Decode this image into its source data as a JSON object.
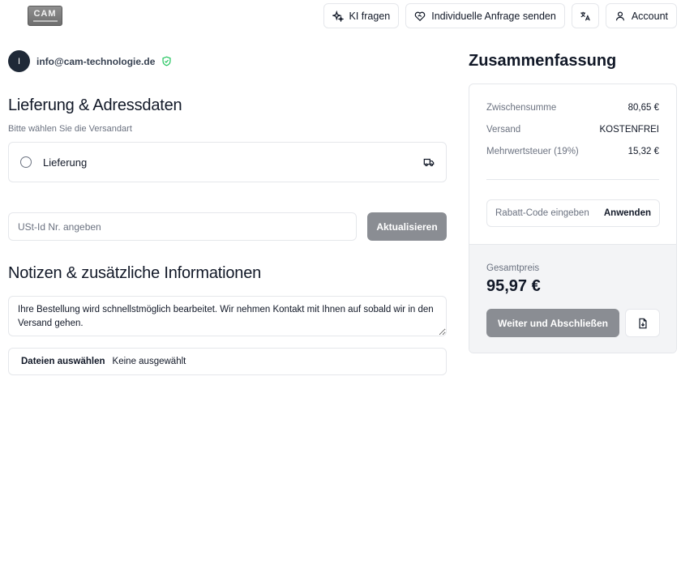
{
  "header": {
    "logo_text": "CAM",
    "buttons": {
      "ai": "KI fragen",
      "request": "Individuelle Anfrage senden",
      "account": "Account"
    }
  },
  "user": {
    "initial": "I",
    "email": "info@cam-technologie.de"
  },
  "delivery_section": {
    "title": "Lieferung & Adressdaten",
    "subtitle": "Bitte wählen Sie die Versandart",
    "option_label": "Lieferung"
  },
  "vat": {
    "placeholder": "USt-Id Nr. angeben",
    "button": "Aktualisieren"
  },
  "notes_section": {
    "title": "Notizen & zusätzliche Informationen",
    "text": "Ihre Bestellung wird schnellstmöglich bearbeitet. Wir nehmen Kontakt mit Ihnen auf sobald wir in den Versand gehen.",
    "file_button": "Dateien auswählen",
    "file_status": "Keine ausgewählt"
  },
  "summary": {
    "title": "Zusammenfassung",
    "lines": [
      {
        "label": "Zwischensumme",
        "value": "80,65 €"
      },
      {
        "label": "Versand",
        "value": "KOSTENFREI"
      },
      {
        "label": "Mehrwertsteuer (19%)",
        "value": "15,32 €"
      }
    ],
    "coupon_placeholder": "Rabatt-Code eingeben",
    "apply": "Anwenden",
    "total_label": "Gesamtpreis",
    "total_value": "95,97 €",
    "checkout": "Weiter und Abschließen"
  },
  "colors": {
    "accent_button": "#8a8d93",
    "verified": "#22c55e",
    "avatar": "#1f2937"
  },
  "icons": [
    "sparkles-icon",
    "heart-handshake-icon",
    "translate-icon",
    "user-icon",
    "shield-check-icon",
    "truck-icon",
    "file-download-icon"
  ]
}
